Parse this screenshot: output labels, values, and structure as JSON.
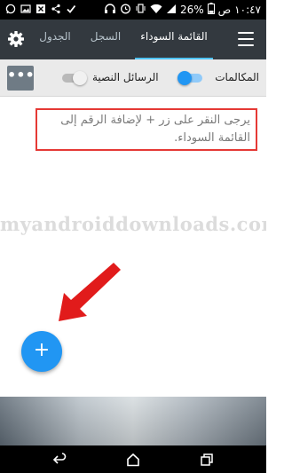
{
  "status_bar": {
    "time": "١٠:٤٧",
    "ampm": "ص",
    "battery": "26%"
  },
  "app_bar": {
    "tabs": [
      {
        "label": "الجدول",
        "selected": false
      },
      {
        "label": "السجل",
        "selected": false
      },
      {
        "label": "القائمة السوداء",
        "selected": true
      }
    ],
    "accent_color": "#4fc3f7",
    "background_color": "#33393f"
  },
  "toolbar": {
    "more_label": "•••",
    "sms_label": "الرسائل النصية",
    "sms_enabled": false,
    "calls_label": "المكالمات",
    "calls_enabled": true,
    "toggle_on_color": "#2196f3"
  },
  "message": {
    "text": "يرجى النقر على زر + لإضافة الرقم إلى القائمة السوداء.",
    "highlight_color": "#e53935"
  },
  "watermark": {
    "text": "myandroiddownloads.com"
  },
  "fab": {
    "label": "+",
    "color": "#2196f3"
  },
  "annotation": {
    "arrow_color": "#e11b1b"
  },
  "icons": {
    "settings": "gear-icon",
    "menu": "hamburger-menu-icon",
    "nav_back": "back-icon",
    "nav_home": "home-icon",
    "nav_recent": "recent-apps-icon"
  }
}
